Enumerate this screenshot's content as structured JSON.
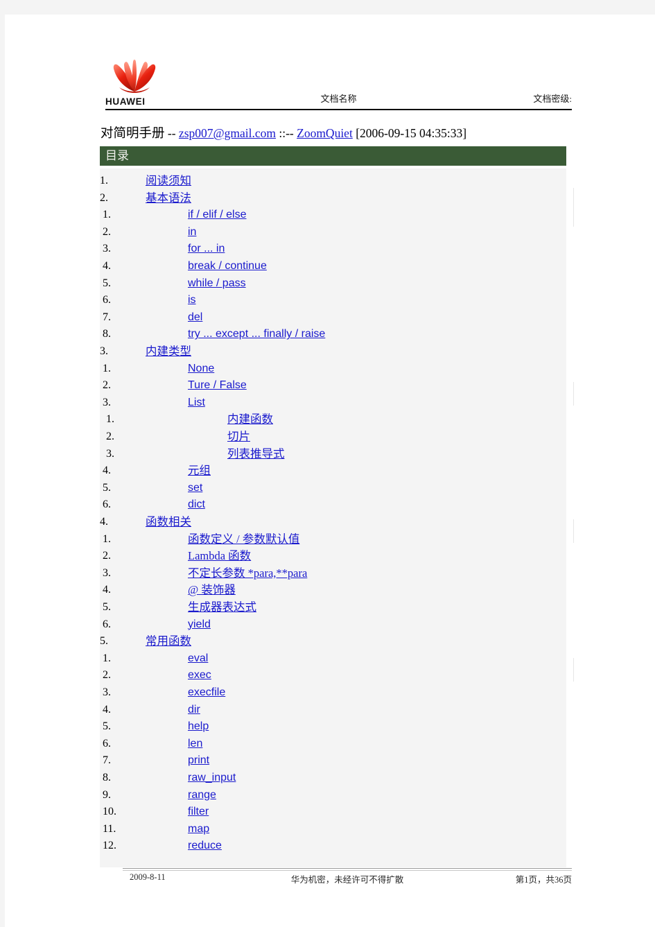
{
  "header": {
    "logo_text": "HUAWEI",
    "logo_icon": "huawei-petal-logo",
    "doc_name": "文档名称",
    "secrecy_label": "文档密级:"
  },
  "byline": {
    "title": "对简明手册",
    "dash": " -- ",
    "email": "zsp007@gmail.com",
    "separator": " ::-- ",
    "author": "ZoomQuiet",
    "timestamp": " [2006-09-15 04:35:33]"
  },
  "toc": {
    "heading": "目录",
    "items": [
      {
        "level": 1,
        "num": "1.",
        "label": "阅读须知",
        "cjk": true
      },
      {
        "level": 1,
        "num": "2.",
        "label": "基本语法",
        "cjk": true
      },
      {
        "level": 2,
        "num": "1.",
        "label": "if / elif / else",
        "cjk": false
      },
      {
        "level": 2,
        "num": "2.",
        "label": "in",
        "cjk": false
      },
      {
        "level": 2,
        "num": "3.",
        "label": "for ... in",
        "cjk": false
      },
      {
        "level": 2,
        "num": "4.",
        "label": "break / continue",
        "cjk": false
      },
      {
        "level": 2,
        "num": "5.",
        "label": "while / pass",
        "cjk": false
      },
      {
        "level": 2,
        "num": "6.",
        "label": "is",
        "cjk": false
      },
      {
        "level": 2,
        "num": "7.",
        "label": "del",
        "cjk": false
      },
      {
        "level": 2,
        "num": "8.",
        "label": "try ... except ... finally / raise",
        "cjk": false
      },
      {
        "level": 1,
        "num": "3.",
        "label": "内建类型",
        "cjk": true
      },
      {
        "level": 2,
        "num": "1.",
        "label": "None",
        "cjk": false
      },
      {
        "level": 2,
        "num": "2.",
        "label": "Ture / False",
        "cjk": false
      },
      {
        "level": 2,
        "num": "3.",
        "label": "List",
        "cjk": false
      },
      {
        "level": 3,
        "num": "1.",
        "label": "内建函数",
        "cjk": true
      },
      {
        "level": 3,
        "num": "2.",
        "label": "切片",
        "cjk": true
      },
      {
        "level": 3,
        "num": "3.",
        "label": "列表推导式",
        "cjk": true
      },
      {
        "level": 2,
        "num": "4.",
        "label": "元组",
        "cjk": true
      },
      {
        "level": 2,
        "num": "5.",
        "label": "set",
        "cjk": false
      },
      {
        "level": 2,
        "num": "6.",
        "label": "dict",
        "cjk": false
      },
      {
        "level": 1,
        "num": "4.",
        "label": "函数相关",
        "cjk": true
      },
      {
        "level": 2,
        "num": "1.",
        "label": "函数定义 / 参数默认值",
        "cjk": true
      },
      {
        "level": 2,
        "num": "2.",
        "label": "Lambda 函数",
        "cjk": true
      },
      {
        "level": 2,
        "num": "3.",
        "label": "不定长参数 *para,**para",
        "cjk": true
      },
      {
        "level": 2,
        "num": "4.",
        "label": "@ 装饰器",
        "cjk": true
      },
      {
        "level": 2,
        "num": "5.",
        "label": "生成器表达式",
        "cjk": true
      },
      {
        "level": 2,
        "num": "6.",
        "label": "yield",
        "cjk": false
      },
      {
        "level": 1,
        "num": "5.",
        "label": "常用函数",
        "cjk": true
      },
      {
        "level": 2,
        "num": "1.",
        "label": "eval",
        "cjk": false
      },
      {
        "level": 2,
        "num": "2.",
        "label": "exec",
        "cjk": false
      },
      {
        "level": 2,
        "num": "3.",
        "label": "execfile",
        "cjk": false
      },
      {
        "level": 2,
        "num": "4.",
        "label": "dir",
        "cjk": false
      },
      {
        "level": 2,
        "num": "5.",
        "label": "help",
        "cjk": false
      },
      {
        "level": 2,
        "num": "6.",
        "label": "len",
        "cjk": false
      },
      {
        "level": 2,
        "num": "7.",
        "label": "print",
        "cjk": false
      },
      {
        "level": 2,
        "num": "8.",
        "label": "raw_input",
        "cjk": false
      },
      {
        "level": 2,
        "num": "9.",
        "label": "range",
        "cjk": false
      },
      {
        "level": 2,
        "num": "10.",
        "label": "filter",
        "cjk": false
      },
      {
        "level": 2,
        "num": "11.",
        "label": "map",
        "cjk": false
      },
      {
        "level": 2,
        "num": "12.",
        "label": "reduce",
        "cjk": false
      }
    ]
  },
  "footer": {
    "date": "2009-8-11",
    "notice": "华为机密，未经许可不得扩散",
    "page": "第1页，共36页"
  },
  "colors": {
    "section_bar": "#3a5b36",
    "link": "#1a1acd",
    "panel_bg": "#f4f4f4",
    "logo_red": "#d81e06"
  }
}
